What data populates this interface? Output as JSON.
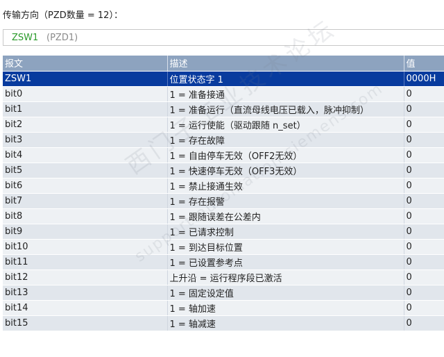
{
  "header": {
    "label": "传输方向（PZD数量 = 12）："
  },
  "selector": {
    "code": "ZSW1",
    "pzd": "(PZD1)"
  },
  "table": {
    "columns": [
      "报文",
      "描述",
      "值"
    ],
    "rows": [
      {
        "msg": "ZSW1",
        "desc": "位置状态字 1",
        "val": "0000H",
        "selected": true
      },
      {
        "msg": "bit0",
        "desc": "1 = 准备接通",
        "val": "0"
      },
      {
        "msg": "bit1",
        "desc": "1 = 准备运行（直流母线电压已载入，脉冲抑制）",
        "val": "0"
      },
      {
        "msg": "bit2",
        "desc": "1 = 运行使能（驱动跟随 n_set）",
        "val": "0"
      },
      {
        "msg": "bit3",
        "desc": "1 = 存在故障",
        "val": "0"
      },
      {
        "msg": "bit4",
        "desc": "1 = 自由停车无效（OFF2无效）",
        "val": "0"
      },
      {
        "msg": "bit5",
        "desc": "1 = 快速停车无效（OFF3无效）",
        "val": "0"
      },
      {
        "msg": "bit6",
        "desc": "1 = 禁止接通生效",
        "val": "0"
      },
      {
        "msg": "bit7",
        "desc": "1 = 存在报警",
        "val": "0"
      },
      {
        "msg": "bit8",
        "desc": "1 = 跟随误差在公差内",
        "val": "0"
      },
      {
        "msg": "bit9",
        "desc": "1 = 已请求控制",
        "val": "0"
      },
      {
        "msg": "bit10",
        "desc": "1 = 到达目标位置",
        "val": "0"
      },
      {
        "msg": "bit11",
        "desc": "1 = 已设置参考点",
        "val": "0"
      },
      {
        "msg": "bit12",
        "desc": "上升沿 = 运行程序段已激活",
        "val": "0"
      },
      {
        "msg": "bit13",
        "desc": "1 = 固定设定值",
        "val": "0"
      },
      {
        "msg": "bit14",
        "desc": "1 = 轴加速",
        "val": "0"
      },
      {
        "msg": "bit15",
        "desc": "1 = 轴减速",
        "val": "0"
      }
    ]
  },
  "watermark": {
    "text": "西门子工业技术论坛",
    "url": "support.automation.siemens.com"
  }
}
